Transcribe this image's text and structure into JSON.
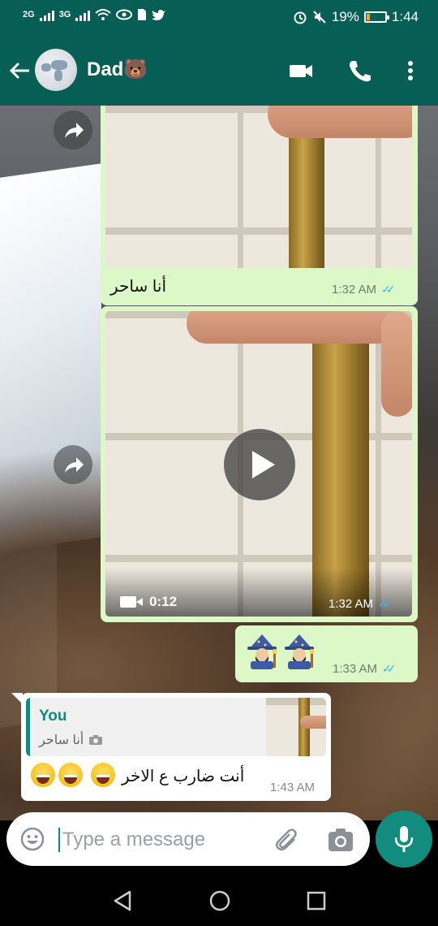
{
  "status_bar": {
    "network_1": "2G",
    "network_2": "3G",
    "battery_percent": "19%",
    "battery_level": 0.19,
    "time": "1:44",
    "icons": [
      "signal-icon",
      "wifi-icon",
      "eye-icon",
      "sim-icon",
      "twitter-icon",
      "alarm-icon",
      "mute-icon",
      "battery-icon"
    ]
  },
  "header": {
    "contact_name": "Dad🐻",
    "icons": [
      "back-arrow-icon",
      "avatar",
      "video-call-icon",
      "phone-icon",
      "more-options-icon"
    ]
  },
  "messages": [
    {
      "type": "image",
      "direction": "outgoing",
      "caption": "أنا ساحر",
      "time": "1:32 AM",
      "ticks": "✓✓"
    },
    {
      "type": "video",
      "direction": "outgoing",
      "duration": "0:12",
      "time": "1:32 AM",
      "ticks": "✓✓"
    },
    {
      "type": "emoji",
      "direction": "outgoing",
      "content": "🧙🏻‍♂️🧙🏻‍♂️",
      "time": "1:33 AM",
      "ticks": "✓✓"
    },
    {
      "type": "reply",
      "direction": "incoming",
      "quote_name": "You",
      "quote_text": "أنا ساحر",
      "text": "أنت ضارب ع الاخر",
      "time": "1:43 AM"
    }
  ],
  "input": {
    "placeholder": "Type a message"
  }
}
